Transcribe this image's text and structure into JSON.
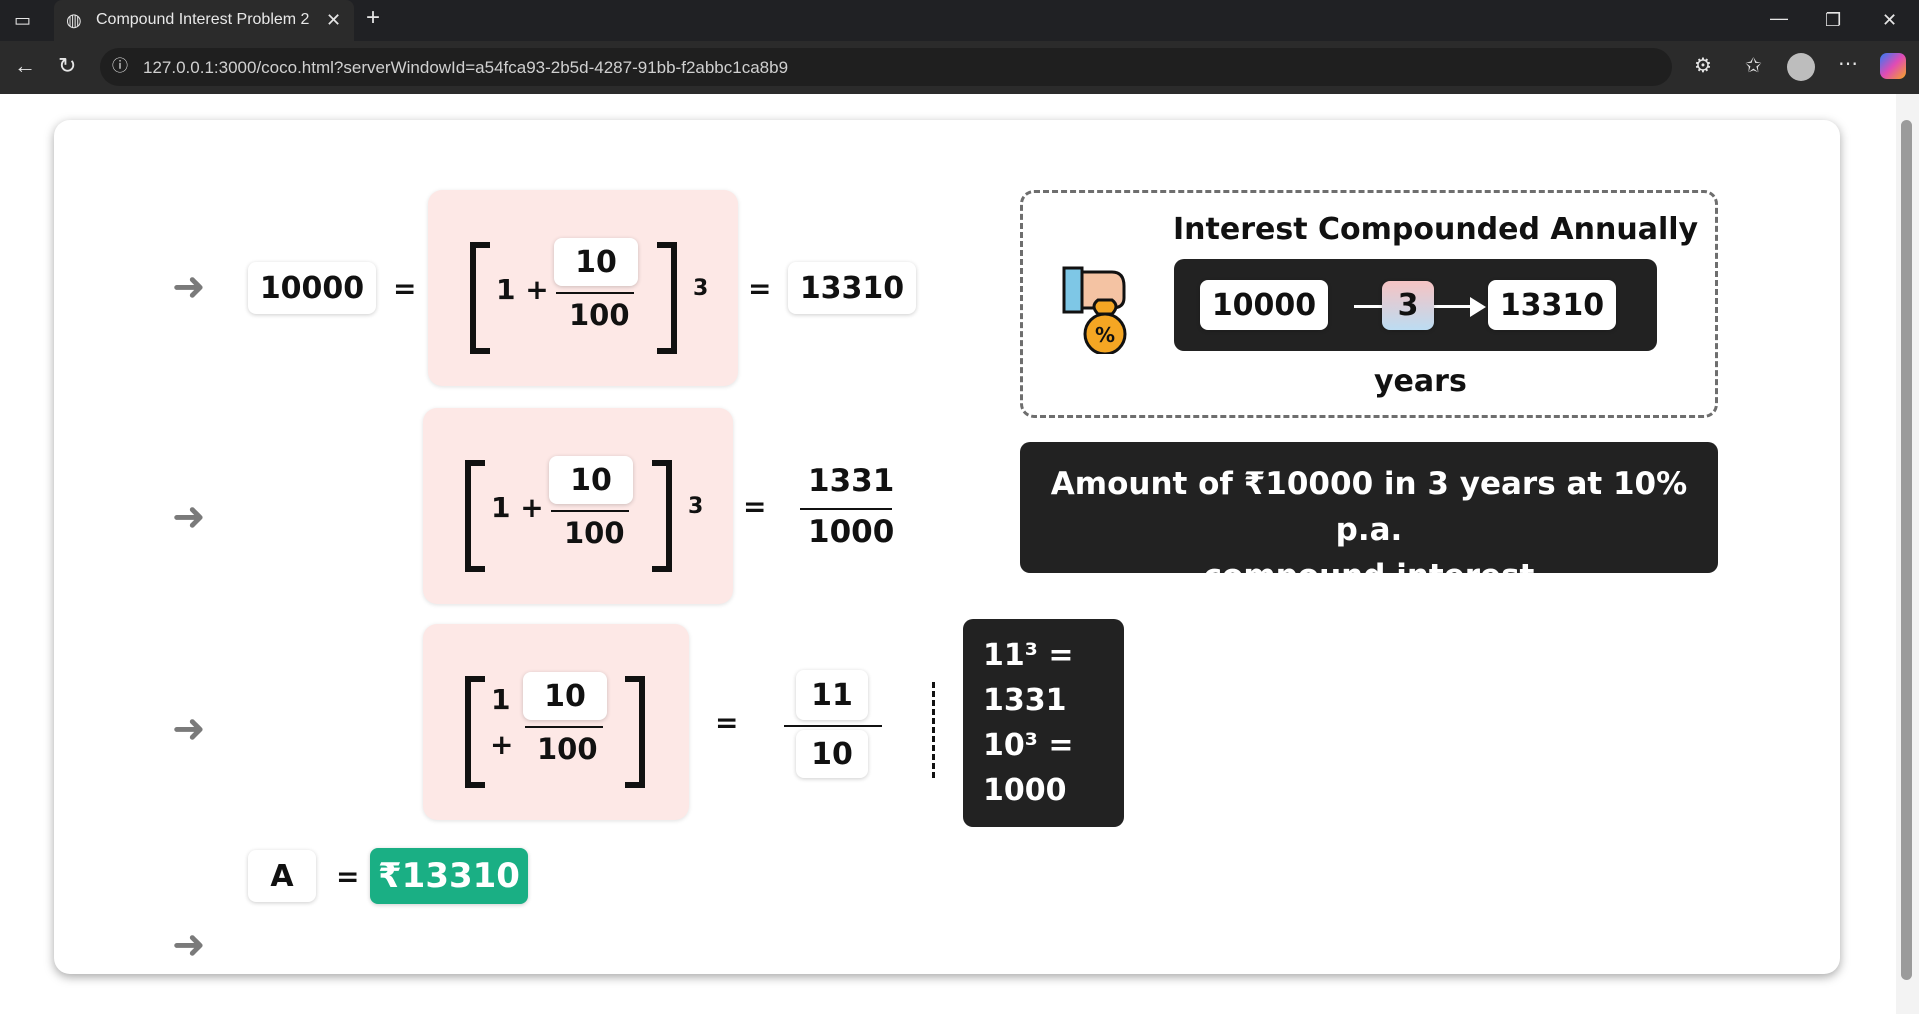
{
  "browser": {
    "tab_title": "Compound Interest Problem 2",
    "url": "127.0.0.1:3000/coco.html?serverWindowId=a54fca93-2b5d-4287-91bb-f2abbc1ca8b9"
  },
  "row1": {
    "left": "10000",
    "eq1": "=",
    "num": "10",
    "den": "100",
    "one_plus": "1 +",
    "exp": "3",
    "eq2": "=",
    "right": "13310"
  },
  "row2": {
    "num": "10",
    "den": "100",
    "one_plus": "1 +",
    "exp": "3",
    "eq": "=",
    "rnum": "1331",
    "rden": "1000"
  },
  "row3": {
    "one": "1",
    "plus": "+",
    "num": "10",
    "den": "100",
    "eq": "=",
    "rnum": "11",
    "rden": "10"
  },
  "powers": {
    "l1": "11³ =",
    "l2": "1331",
    "l3": "10³ =",
    "l4": "1000"
  },
  "result": {
    "label": "A",
    "eq": "=",
    "value": "₹13310"
  },
  "panel": {
    "title": "Interest Compounded Annually",
    "start": "10000",
    "years_num": "3",
    "end": "13310",
    "years_label": "years"
  },
  "banner": {
    "line1": "Amount of ₹10000 in 3 years at 10% p.a.",
    "line2": "compound interest"
  },
  "arrows": {
    "glyph": "➜"
  },
  "colors": {
    "pink": "#fde8e6",
    "dark": "#222222",
    "green": "#1aaf84"
  }
}
